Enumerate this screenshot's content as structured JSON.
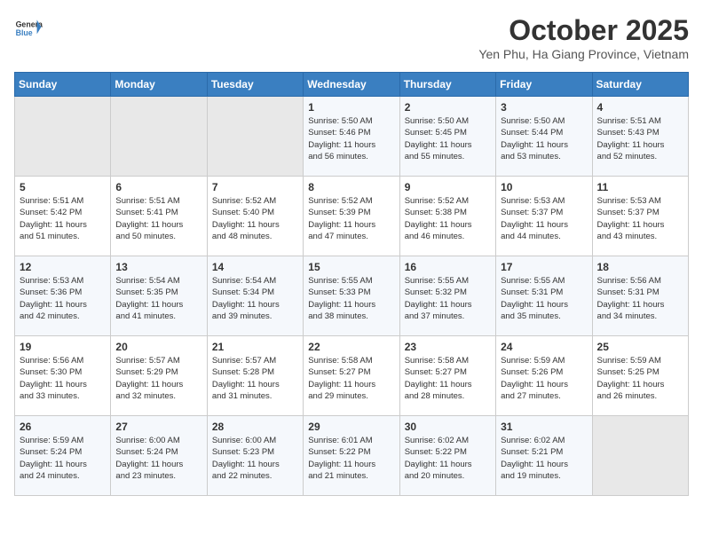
{
  "header": {
    "logo_line1": "General",
    "logo_line2": "Blue",
    "month": "October 2025",
    "location": "Yen Phu, Ha Giang Province, Vietnam"
  },
  "days_of_week": [
    "Sunday",
    "Monday",
    "Tuesday",
    "Wednesday",
    "Thursday",
    "Friday",
    "Saturday"
  ],
  "weeks": [
    [
      {
        "day": "",
        "data": ""
      },
      {
        "day": "",
        "data": ""
      },
      {
        "day": "",
        "data": ""
      },
      {
        "day": "1",
        "data": "Sunrise: 5:50 AM\nSunset: 5:46 PM\nDaylight: 11 hours\nand 56 minutes."
      },
      {
        "day": "2",
        "data": "Sunrise: 5:50 AM\nSunset: 5:45 PM\nDaylight: 11 hours\nand 55 minutes."
      },
      {
        "day": "3",
        "data": "Sunrise: 5:50 AM\nSunset: 5:44 PM\nDaylight: 11 hours\nand 53 minutes."
      },
      {
        "day": "4",
        "data": "Sunrise: 5:51 AM\nSunset: 5:43 PM\nDaylight: 11 hours\nand 52 minutes."
      }
    ],
    [
      {
        "day": "5",
        "data": "Sunrise: 5:51 AM\nSunset: 5:42 PM\nDaylight: 11 hours\nand 51 minutes."
      },
      {
        "day": "6",
        "data": "Sunrise: 5:51 AM\nSunset: 5:41 PM\nDaylight: 11 hours\nand 50 minutes."
      },
      {
        "day": "7",
        "data": "Sunrise: 5:52 AM\nSunset: 5:40 PM\nDaylight: 11 hours\nand 48 minutes."
      },
      {
        "day": "8",
        "data": "Sunrise: 5:52 AM\nSunset: 5:39 PM\nDaylight: 11 hours\nand 47 minutes."
      },
      {
        "day": "9",
        "data": "Sunrise: 5:52 AM\nSunset: 5:38 PM\nDaylight: 11 hours\nand 46 minutes."
      },
      {
        "day": "10",
        "data": "Sunrise: 5:53 AM\nSunset: 5:37 PM\nDaylight: 11 hours\nand 44 minutes."
      },
      {
        "day": "11",
        "data": "Sunrise: 5:53 AM\nSunset: 5:37 PM\nDaylight: 11 hours\nand 43 minutes."
      }
    ],
    [
      {
        "day": "12",
        "data": "Sunrise: 5:53 AM\nSunset: 5:36 PM\nDaylight: 11 hours\nand 42 minutes."
      },
      {
        "day": "13",
        "data": "Sunrise: 5:54 AM\nSunset: 5:35 PM\nDaylight: 11 hours\nand 41 minutes."
      },
      {
        "day": "14",
        "data": "Sunrise: 5:54 AM\nSunset: 5:34 PM\nDaylight: 11 hours\nand 39 minutes."
      },
      {
        "day": "15",
        "data": "Sunrise: 5:55 AM\nSunset: 5:33 PM\nDaylight: 11 hours\nand 38 minutes."
      },
      {
        "day": "16",
        "data": "Sunrise: 5:55 AM\nSunset: 5:32 PM\nDaylight: 11 hours\nand 37 minutes."
      },
      {
        "day": "17",
        "data": "Sunrise: 5:55 AM\nSunset: 5:31 PM\nDaylight: 11 hours\nand 35 minutes."
      },
      {
        "day": "18",
        "data": "Sunrise: 5:56 AM\nSunset: 5:31 PM\nDaylight: 11 hours\nand 34 minutes."
      }
    ],
    [
      {
        "day": "19",
        "data": "Sunrise: 5:56 AM\nSunset: 5:30 PM\nDaylight: 11 hours\nand 33 minutes."
      },
      {
        "day": "20",
        "data": "Sunrise: 5:57 AM\nSunset: 5:29 PM\nDaylight: 11 hours\nand 32 minutes."
      },
      {
        "day": "21",
        "data": "Sunrise: 5:57 AM\nSunset: 5:28 PM\nDaylight: 11 hours\nand 31 minutes."
      },
      {
        "day": "22",
        "data": "Sunrise: 5:58 AM\nSunset: 5:27 PM\nDaylight: 11 hours\nand 29 minutes."
      },
      {
        "day": "23",
        "data": "Sunrise: 5:58 AM\nSunset: 5:27 PM\nDaylight: 11 hours\nand 28 minutes."
      },
      {
        "day": "24",
        "data": "Sunrise: 5:59 AM\nSunset: 5:26 PM\nDaylight: 11 hours\nand 27 minutes."
      },
      {
        "day": "25",
        "data": "Sunrise: 5:59 AM\nSunset: 5:25 PM\nDaylight: 11 hours\nand 26 minutes."
      }
    ],
    [
      {
        "day": "26",
        "data": "Sunrise: 5:59 AM\nSunset: 5:24 PM\nDaylight: 11 hours\nand 24 minutes."
      },
      {
        "day": "27",
        "data": "Sunrise: 6:00 AM\nSunset: 5:24 PM\nDaylight: 11 hours\nand 23 minutes."
      },
      {
        "day": "28",
        "data": "Sunrise: 6:00 AM\nSunset: 5:23 PM\nDaylight: 11 hours\nand 22 minutes."
      },
      {
        "day": "29",
        "data": "Sunrise: 6:01 AM\nSunset: 5:22 PM\nDaylight: 11 hours\nand 21 minutes."
      },
      {
        "day": "30",
        "data": "Sunrise: 6:02 AM\nSunset: 5:22 PM\nDaylight: 11 hours\nand 20 minutes."
      },
      {
        "day": "31",
        "data": "Sunrise: 6:02 AM\nSunset: 5:21 PM\nDaylight: 11 hours\nand 19 minutes."
      },
      {
        "day": "",
        "data": ""
      }
    ]
  ]
}
